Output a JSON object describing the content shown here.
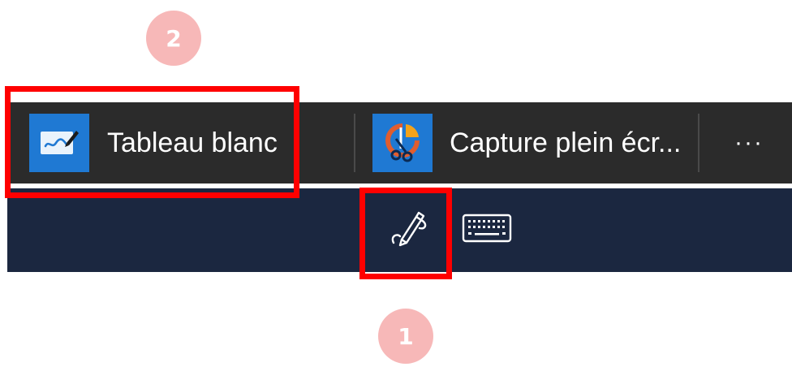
{
  "annotations": {
    "badge_1": "1",
    "badge_2": "2",
    "highlight_color": "#ff0000",
    "badge_color": "#f7b8b8"
  },
  "pen_menu": {
    "items": [
      {
        "label": "Tableau blanc",
        "icon": "whiteboard-icon"
      },
      {
        "label": "Capture plein écr...",
        "icon": "snip-sketch-icon"
      }
    ],
    "more_label": "···"
  },
  "taskbar": {
    "buttons": [
      {
        "name": "windows-ink-workspace",
        "icon": "pen-icon"
      },
      {
        "name": "touch-keyboard",
        "icon": "keyboard-icon"
      }
    ],
    "background": "#1b2740"
  }
}
